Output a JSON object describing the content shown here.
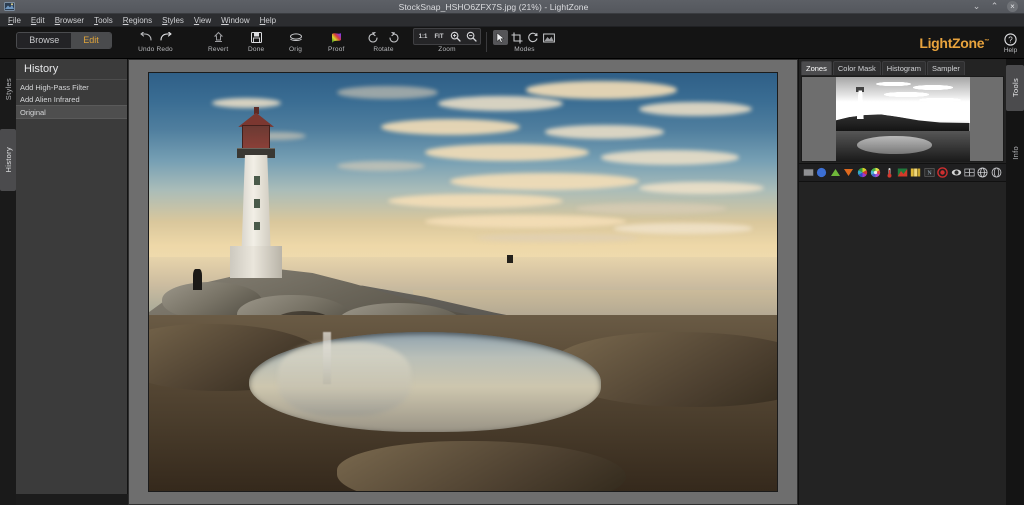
{
  "window": {
    "title": "StockSnap_HSHO6ZFX7S.jpg (21%) - LightZone",
    "app_icon": "image-file-icon",
    "controls": {
      "minimize": "⌄",
      "maximize": "⌃",
      "close": "×"
    }
  },
  "menubar": {
    "items": [
      {
        "label": "File",
        "mnemonic": "F"
      },
      {
        "label": "Edit",
        "mnemonic": "E"
      },
      {
        "label": "Browser",
        "mnemonic": "B"
      },
      {
        "label": "Tools",
        "mnemonic": "T"
      },
      {
        "label": "Regions",
        "mnemonic": "R"
      },
      {
        "label": "Styles",
        "mnemonic": "S"
      },
      {
        "label": "View",
        "mnemonic": "V"
      },
      {
        "label": "Window",
        "mnemonic": "W"
      },
      {
        "label": "Help",
        "mnemonic": "H"
      }
    ]
  },
  "toolbar": {
    "mode_switch": {
      "browse_label": "Browse",
      "edit_label": "Edit",
      "active": "Edit"
    },
    "groups": {
      "undo_redo": {
        "label": "Undo Redo",
        "undo_icon": "undo-arrow-icon",
        "redo_icon": "redo-arrow-icon"
      },
      "revert": {
        "label": "Revert",
        "icon": "revert-icon"
      },
      "done": {
        "label": "Done",
        "icon": "save-floppy-icon"
      },
      "orig": {
        "label": "Orig",
        "icon": "original-layers-icon"
      },
      "proof": {
        "label": "Proof",
        "icon": "color-proof-icon"
      },
      "rotate": {
        "label": "Rotate",
        "left_icon": "rotate-left-icon",
        "right_icon": "rotate-right-icon"
      },
      "zoom": {
        "label": "Zoom",
        "one_to_one": "1:1",
        "fit": "FIT",
        "zoom_in_icon": "zoom-in-icon",
        "zoom_out_icon": "zoom-out-icon"
      },
      "modes": {
        "label": "Modes",
        "buttons": [
          {
            "name": "pointer-mode",
            "icon": "arrow-pointer-icon",
            "active": true
          },
          {
            "name": "crop-mode",
            "icon": "crop-icon",
            "active": false
          },
          {
            "name": "rotate-mode",
            "icon": "rotate-circle-icon",
            "active": false
          },
          {
            "name": "region-mode",
            "icon": "region-frame-icon",
            "active": false
          }
        ]
      }
    },
    "brand": {
      "name": "LightZone",
      "trademark": "™"
    },
    "help": {
      "label": "Help",
      "icon": "question-circle-icon"
    }
  },
  "left_sidebar": {
    "vertical_tabs": [
      {
        "label": "Styles",
        "active": false
      },
      {
        "label": "History",
        "active": true
      }
    ],
    "history": {
      "title": "History",
      "items": [
        {
          "label": "Add High-Pass Filter",
          "selected": false
        },
        {
          "label": "Add Alien Infrared",
          "selected": false
        },
        {
          "label": "Original",
          "selected": true
        }
      ]
    }
  },
  "canvas": {
    "image_name": "StockSnap_HSHO6ZFX7S.jpg",
    "zoom_percent": "21%",
    "description": "Peggys Cove lighthouse on granite rocks at sunset with tidal pool reflection"
  },
  "right_panel": {
    "tabs": [
      {
        "label": "Zones",
        "active": true
      },
      {
        "label": "Color Mask",
        "active": false
      },
      {
        "label": "Histogram",
        "active": false
      },
      {
        "label": "Sampler",
        "active": false
      }
    ],
    "tool_icons": [
      {
        "name": "zone-mapper-icon"
      },
      {
        "name": "relight-icon"
      },
      {
        "name": "sharpen-icon"
      },
      {
        "name": "noise-reduction-icon"
      },
      {
        "name": "hue-saturation-icon"
      },
      {
        "name": "color-balance-icon"
      },
      {
        "name": "white-balance-icon"
      },
      {
        "name": "black-white-icon"
      },
      {
        "name": "advanced-icon"
      },
      {
        "name": "clone-icon"
      },
      {
        "name": "spot-icon"
      },
      {
        "name": "red-eye-icon"
      },
      {
        "name": "blur-icon"
      },
      {
        "name": "film-grain-icon"
      },
      {
        "name": "gaussian-blur-icon"
      }
    ],
    "vertical_tabs": [
      {
        "label": "Tools",
        "active": true
      },
      {
        "label": "Info",
        "active": false
      }
    ]
  },
  "colors": {
    "brand_orange": "#e8a33d",
    "titlebar": "#585b61",
    "toolbar_bg": "#141414",
    "panel_bg": "#3b3b3b",
    "canvas_bg": "#6e6e6e"
  }
}
